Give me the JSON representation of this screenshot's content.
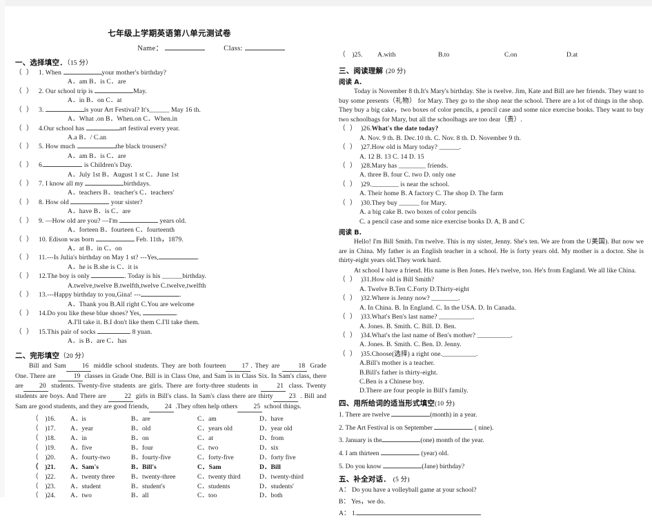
{
  "document": {
    "title": "七年级上学期英语第八单元测试卷",
    "name_label": "Name：",
    "class_label": "Class:"
  },
  "section1": {
    "heading": "一、选择填空．",
    "points": "（15 分）",
    "questions": [
      {
        "num": "1.",
        "stem_a": "When",
        "stem_b": "your mother's birthday?",
        "options": "A．am   B．is   C．are"
      },
      {
        "num": "2.",
        "stem_a": "Our school trip is",
        "stem_b": "May.",
        "options": "A．in    B．on    C．at"
      },
      {
        "num": "3.",
        "stem_a": "",
        "stem_b": "is your Art Festival?      It's______ May 16 th.",
        "options": "A．What .on   B．When.on   C．When.in"
      },
      {
        "num": "4.",
        "stem_a": "Our school has",
        "stem_b": "art festival every year.",
        "options": "A.a          B．/       C.an"
      },
      {
        "num": "5.",
        "stem_a": "How much",
        "stem_b": "the black trousers?",
        "options": "A．am     B．is    C．are"
      },
      {
        "num": "6.",
        "stem_a": "",
        "stem_b": "is Children's Day.",
        "options": "A．July 1st   B．August 1 st     C．June 1st"
      },
      {
        "num": "7.",
        "stem_a": "I know all my",
        "stem_b": "birthdays.",
        "options": "A．teachers     B．teacher's   C．teachers'"
      },
      {
        "num": "8.",
        "stem_a": "How old",
        "stem_b": "your sister?",
        "options": "A．have     B．is              C．are"
      },
      {
        "num": "9.",
        "stem_a": "—How old are you?      —I'm",
        "stem_b": "years old.",
        "options": "A．forteen B．fourteen C．fourteenth"
      },
      {
        "num": "10.",
        "stem_a": "Edison was born",
        "stem_b": "Feb. 11th，1879.",
        "options": "A．at B．in  C．on"
      },
      {
        "num": "11.",
        "stem_a": "---Is Julia's birthday on May 1 st?   ---Yes,",
        "stem_b": ".",
        "options": "A．he is   B.she is  C．it is"
      },
      {
        "num": "12.",
        "stem_a": "The boy is only",
        "stem_b": ". Today is his ______birthday.",
        "options": "A.twelve,twelve    B.twelfth,twelve    C.twelve,twelfth"
      },
      {
        "num": "13.",
        "stem_a": "---Happy birthday to you,Gina! ---",
        "stem_b": ".",
        "options": "A．Thank you    B.All right            C.You are welcome"
      },
      {
        "num": "14.",
        "stem_a": "Do you like these blue shoes? Yes,",
        "stem_b": ".",
        "options": "A.I'll take it.       B.I don't like them   C.I'll take them."
      },
      {
        "num": "15.",
        "stem_a": "This pair of socks",
        "stem_b": "8 yuan.",
        "options": "A．is   B．are   C．has"
      }
    ]
  },
  "section2": {
    "heading": "二、完形填空",
    "points": "（20 分）",
    "passage_parts": [
      "Bill and Sam",
      "middle school students. They are both fourteen",
      ". They are",
      "Grade One. There are",
      "classes in Grade One. Bill is in Class One, and Sam is in Class Six. In Sam's class, there are",
      "students. Twenty-five students are girls. There are forty-three students in",
      "class. Twenty students are boys. And There are",
      "girls in Bill's class. In Sam's class there are thirty",
      ". Bill and Sam are good students, and they are good friends,",
      ".They often help others",
      "school things."
    ],
    "blank_numbers": [
      "16",
      "17",
      "18",
      "19",
      "20",
      "21",
      "22",
      "23",
      "24",
      "25"
    ],
    "options": [
      {
        "num": ")16.",
        "a": "A．is",
        "b": "B．are",
        "c": "C．am",
        "d": "D．have"
      },
      {
        "num": ")17.",
        "a": "A．year",
        "b": "B．old",
        "c": "C．years old",
        "d": "D．year old"
      },
      {
        "num": ")18.",
        "a": "A．in",
        "b": "B．on",
        "c": "C．at",
        "d": "D．from"
      },
      {
        "num": ")19.",
        "a": "A．five",
        "b": "B．four",
        "c": "C．two",
        "d": "D．six"
      },
      {
        "num": ")20.",
        "a": "A．fourty-two",
        "b": "B．fourty-five",
        "c": "C．forty-five",
        "d": "D．forty five"
      },
      {
        "num": ")21.",
        "a": "A．Sam's",
        "b": "B．Bill's",
        "c": "C．Sam",
        "d": "D．Bill"
      },
      {
        "num": ")22.",
        "a": "A．twenty three",
        "b": "B．twenty-three",
        "c": "C．twenty third",
        "d": "D．twenty-third"
      },
      {
        "num": ")23.",
        "a": "A．student",
        "b": "B．student's",
        "c": "C．students",
        "d": "D．students'"
      },
      {
        "num": ")24.",
        "a": "A．two",
        "b": "B．all",
        "c": "C．too",
        "d": "D．both"
      }
    ],
    "q25": {
      "num": ")25.",
      "a": "A.with",
      "b": "B.to",
      "c": "C.on",
      "d": "D.at"
    }
  },
  "section3": {
    "heading": "三、阅读理解",
    "points": "(20 分)",
    "passage_a_label": "阅读 A.",
    "passage_a": "Today is November 8 th.It's Mary's birthday. She is twelve. Jim, Kate and Bill are her friends. They want to buy some presents（礼物） for Mary. They go to the shop near the school. There are a lot of things in the shop. They buy a big cake，two boxes of color pencils, a pencil case and some nice exercise books. They want to buy two schoolbags for Mary, but all the schoolbags are too dear（贵）.",
    "questions_a": [
      {
        "num": ")26.",
        "stem": "What's the date today?",
        "options": "A. Nov. 9 th.   B. Dec.10 th.   C.   Nov. 8 th.     D. November 9 th."
      },
      {
        "num": ")27.",
        "stem": "How old is Mary today? ______.",
        "options": "A. 12         B. 13      C. 14      D. 15"
      },
      {
        "num": ")28.",
        "stem": "Mary has ________ friends.",
        "options": "A. three      B. four     C. two     D. only one"
      },
      {
        "num": ")29.",
        "stem": "________ is near the school.",
        "options": "A. Their home   B. A factory   C. The shop   D. The farm"
      },
      {
        "num": ")30.",
        "stem": "They buy ______ for Mary.",
        "options": "A. a big cake     B. two boxes of color pencils",
        "options2": "C. a pencil case and some nice exercise books        D. A, B and C"
      }
    ],
    "passage_b_label": "阅读 B.",
    "passage_b_p1": "Hello! I'm Bill Smith. I'm twelve. This is my sister, Jenny. She's ten. We are from the U美国). But now we are in China. My father is an English teacher in a school. He is forty years old. My mother is a doctor. She is thirty-eight years old.They work hard.",
    "passage_b_p2": "At school I have a friend. His name is Ben Jones. He's twelve, too. He's from England. We all like China.",
    "questions_b": [
      {
        "num": ")31.",
        "stem": "How old is Bill Smith?",
        "options": "A. Twelve          B.Ten                  C.Forty                   D.Thirty-eight"
      },
      {
        "num": ")32.",
        "stem": "Where is Jenny now? ________.",
        "options": "A. In China.    B. In England.    C. In the USA.    D. In Canada."
      },
      {
        "num": ")33.",
        "stem": "What's Ben's last name? __________.",
        "options": "A. Jones.             B. Smith.             C. Bill.               D. Ben."
      },
      {
        "num": ")34.",
        "stem": "What's the last name of Ben's mother? __________.",
        "options": "A. Jones.             B. Smith.             C. Ben.               D. Jenny."
      },
      {
        "num": ")35.",
        "stem": "Choose(选择) a right one.__________.",
        "options": "A.Bill's mother is a teacher.",
        "options2": "B.Bill's father is thirty-eight.",
        "options3": "C.Ben is a Chinese boy.",
        "options4": "D.There are four people in Bill's family."
      }
    ]
  },
  "section4": {
    "heading": "四、用所给词的适当形式填空",
    "points": "(10 分)",
    "items": [
      {
        "pre": "1. There are twelve",
        "post": "(month) in a year."
      },
      {
        "pre": "2. The Art Festival is on September",
        "post": "( nine)."
      },
      {
        "pre": "3. January is the",
        "post": "(one) month of the year."
      },
      {
        "pre": "4. I am thirteen",
        "post": "(year) old."
      },
      {
        "pre": "5. Do you know",
        "post": "(Jane) birthday?"
      }
    ]
  },
  "section5": {
    "heading": "五、补全对话．",
    "points": "(5 分)",
    "lines": [
      {
        "speaker": "A：",
        "text": "Do you have a volleyball game at your school?"
      },
      {
        "speaker": "B：",
        "text": "Yes，we do."
      },
      {
        "speaker": "A：",
        "text": "1."
      }
    ]
  }
}
